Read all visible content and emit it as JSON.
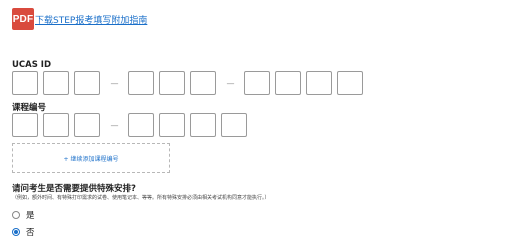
{
  "header": {
    "pdf_icon": "PDF",
    "pdf_link": "下载STEP报考填写附加指南"
  },
  "ucas": {
    "label": "UCAS ID",
    "groups": [
      3,
      3,
      4
    ]
  },
  "course": {
    "label": "课程编号",
    "groups": [
      3,
      4
    ],
    "add_label": "+ 继续添加课程编号"
  },
  "special": {
    "question": "请问考生是否需要提供特殊安排?",
    "hint": "（例如，额外时间、有特殊打印需求的试卷、使用笔记本、等等。所有特殊安排必须由相关考试机构同意才能执行。）",
    "options": [
      {
        "label": "是",
        "checked": false
      },
      {
        "label": "否",
        "checked": true
      }
    ]
  },
  "colors": {
    "accent": "#1a6fc9",
    "pdf_red": "#d94a3d"
  }
}
